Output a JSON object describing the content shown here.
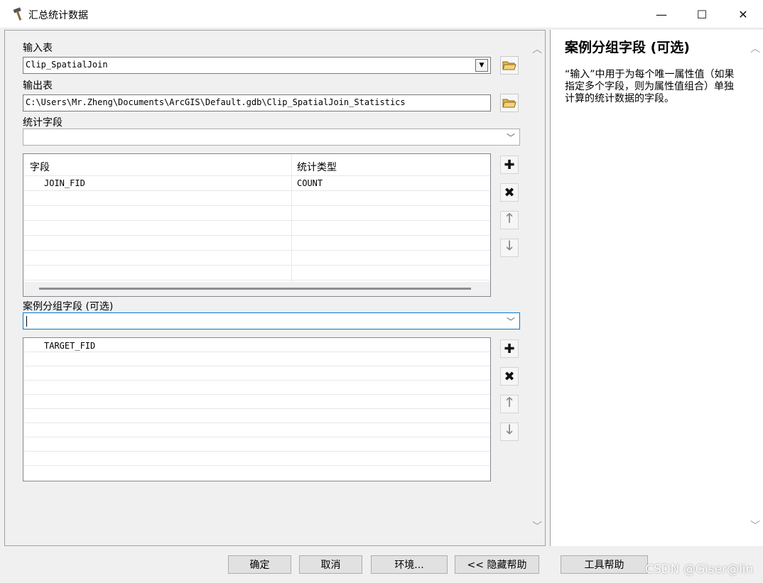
{
  "window": {
    "title": "汇总统计数据",
    "minimize": "—",
    "maximize": "☐",
    "close": "✕"
  },
  "input_table": {
    "label": "输入表",
    "value": "Clip_SpatialJoin"
  },
  "output_table": {
    "label": "输出表",
    "value": "C:\\Users\\Mr.Zheng\\Documents\\ArcGIS\\Default.gdb\\Clip_SpatialJoin_Statistics"
  },
  "stat_fields": {
    "label": "统计字段",
    "columns": [
      "字段",
      "统计类型"
    ],
    "rows": [
      {
        "field": "JOIN_FID",
        "type": "COUNT"
      }
    ]
  },
  "case_field": {
    "label": "案例分组字段 (可选)",
    "value": "",
    "items": [
      "TARGET_FID"
    ]
  },
  "icons": {
    "add": "plus-icon",
    "remove": "x-icon",
    "up": "arrow-up-icon",
    "down": "arrow-down-icon",
    "folder": "folder-open-icon"
  },
  "help": {
    "title": "案例分组字段 (可选)",
    "text": "“输入”中用于为每个唯一属性值（如果指定多个字段，则为属性值组合）单独计算的统计数据的字段。"
  },
  "buttons": {
    "ok": "确定",
    "cancel": "取消",
    "env": "环境...",
    "hide_help": "<< 隐藏帮助",
    "tool_help": "工具帮助"
  },
  "watermark": "CSDN @Giser@lin"
}
